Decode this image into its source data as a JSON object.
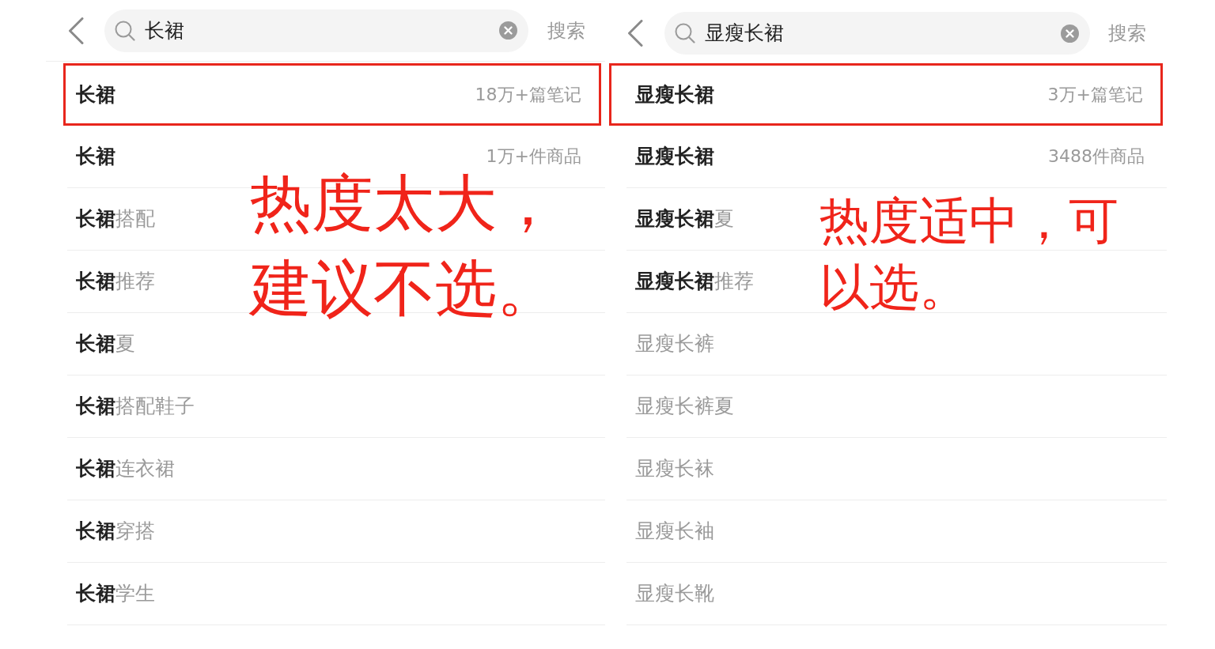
{
  "panels": [
    {
      "search": {
        "query": "长裙",
        "button": "搜索"
      },
      "suggestions": [
        {
          "match": "长裙",
          "count": "18万+篇笔记",
          "highlighted": true
        },
        {
          "match": "长裙",
          "count": "1万+件商品",
          "highlighted": false
        },
        {
          "match": "长裙",
          "completion": "搭配",
          "highlighted": false
        },
        {
          "match": "长裙",
          "completion": "推荐",
          "highlighted": false
        },
        {
          "match": "长裙",
          "completion": "夏",
          "highlighted": false
        },
        {
          "match": "长裙",
          "completion": "搭配鞋子",
          "highlighted": false
        },
        {
          "match": "长裙",
          "completion": "连衣裙",
          "highlighted": false
        },
        {
          "match": "长裙",
          "completion": "穿搭",
          "highlighted": false
        },
        {
          "match": "长裙",
          "completion": "学生",
          "highlighted": false
        }
      ],
      "annotation": "热度太大，建议不选。"
    },
    {
      "search": {
        "query": "显瘦长裙",
        "button": "搜索"
      },
      "suggestions": [
        {
          "match": "显瘦长裙",
          "count": "3万+篇笔记",
          "highlighted": true
        },
        {
          "match": "显瘦长裙",
          "count": "3488件商品",
          "highlighted": false
        },
        {
          "match": "显瘦长裙",
          "completion": "夏",
          "highlighted": false
        },
        {
          "match": "显瘦长裙",
          "completion": "推荐",
          "highlighted": false
        },
        {
          "completion": "显瘦长裤",
          "highlighted": false
        },
        {
          "completion": "显瘦长裤夏",
          "highlighted": false
        },
        {
          "completion": "显瘦长袜",
          "highlighted": false
        },
        {
          "completion": "显瘦长袖",
          "highlighted": false
        },
        {
          "completion": "显瘦长靴",
          "highlighted": false
        }
      ],
      "annotation": "热度适中，可以选。"
    }
  ]
}
